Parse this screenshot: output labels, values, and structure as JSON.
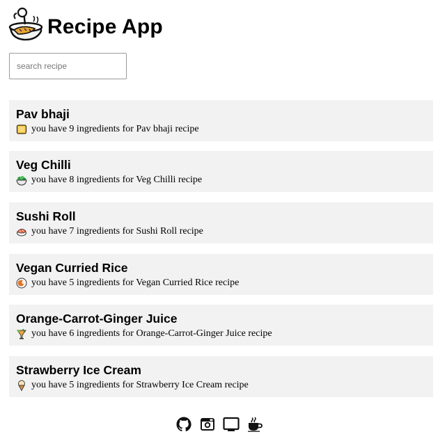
{
  "app": {
    "title": "Recipe App",
    "logo_icon": "chef-cooking-pot-icon"
  },
  "search": {
    "placeholder": "search recipe",
    "value": ""
  },
  "recipes": [
    {
      "name": "Pav bhaji",
      "description": "you have 9 ingredients for Pav bhaji recipe",
      "icon": "bread-icon"
    },
    {
      "name": "Veg Chilli",
      "description": "you have 8 ingredients for Veg Chilli recipe",
      "icon": "salad-bowl-icon"
    },
    {
      "name": "Sushi Roll",
      "description": "you have 7 ingredients for Sushi Roll recipe",
      "icon": "sushi-icon"
    },
    {
      "name": "Vegan Curried Rice",
      "description": "you have 5 ingredients for Vegan Curried Rice recipe",
      "icon": "curry-plate-icon"
    },
    {
      "name": "Orange-Carrot-Ginger Juice",
      "description": "you have 6 ingredients for Orange-Carrot-Ginger Juice recipe",
      "icon": "tropical-drink-icon"
    },
    {
      "name": "Strawberry Ice Cream",
      "description": "you have 5 ingredients for Strawberry Ice Cream recipe",
      "icon": "ice-cream-cone-icon"
    }
  ],
  "footer": {
    "links": [
      {
        "icon": "github-icon"
      },
      {
        "icon": "instagram-icon"
      },
      {
        "icon": "tablet-icon"
      },
      {
        "icon": "coffee-cup-icon"
      }
    ]
  }
}
